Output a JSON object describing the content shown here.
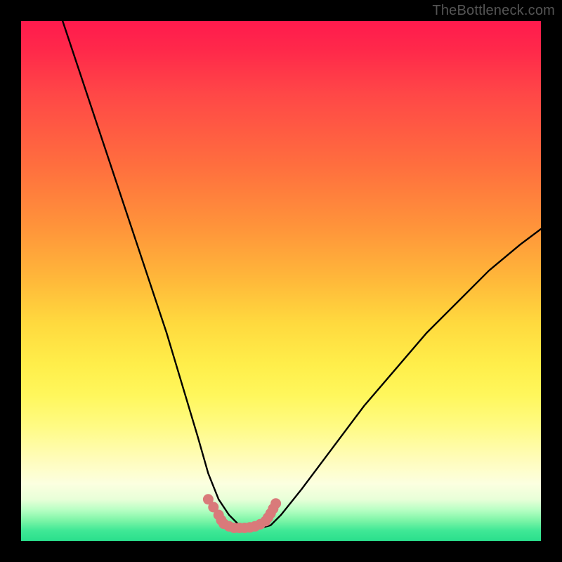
{
  "watermark": "TheBottleneck.com",
  "chart_data": {
    "type": "line",
    "title": "",
    "xlabel": "",
    "ylabel": "",
    "xlim": [
      0,
      100
    ],
    "ylim": [
      0,
      100
    ],
    "series": [
      {
        "name": "bottleneck-curve",
        "x": [
          8,
          12,
          16,
          20,
          24,
          28,
          31,
          34,
          36,
          38,
          40,
          42,
          44,
          46,
          48,
          50,
          54,
          60,
          66,
          72,
          78,
          84,
          90,
          96,
          100
        ],
        "y": [
          100,
          88,
          76,
          64,
          52,
          40,
          30,
          20,
          13,
          8,
          5,
          3,
          2.5,
          2.5,
          3,
          5,
          10,
          18,
          26,
          33,
          40,
          46,
          52,
          57,
          60
        ]
      }
    ],
    "gradient_stops": [
      {
        "pct": 0,
        "color": "#ff1a4d"
      },
      {
        "pct": 28,
        "color": "#ff6f3e"
      },
      {
        "pct": 58,
        "color": "#ffd93e"
      },
      {
        "pct": 84,
        "color": "#fffcb8"
      },
      {
        "pct": 96,
        "color": "#7ff5a8"
      },
      {
        "pct": 100,
        "color": "#2adf8c"
      }
    ],
    "markers": {
      "color": "#d97a7a",
      "points_xy": [
        [
          36,
          8
        ],
        [
          37,
          6.5
        ],
        [
          38,
          5
        ],
        [
          38.5,
          4
        ],
        [
          39,
          3.3
        ],
        [
          40,
          2.8
        ],
        [
          41,
          2.5
        ],
        [
          42,
          2.5
        ],
        [
          43,
          2.5
        ],
        [
          44,
          2.6
        ],
        [
          45,
          2.8
        ],
        [
          46,
          3.2
        ],
        [
          47,
          3.8
        ],
        [
          47.5,
          4.5
        ],
        [
          48,
          5.3
        ],
        [
          48.5,
          6.2
        ],
        [
          49,
          7.2
        ]
      ]
    }
  }
}
